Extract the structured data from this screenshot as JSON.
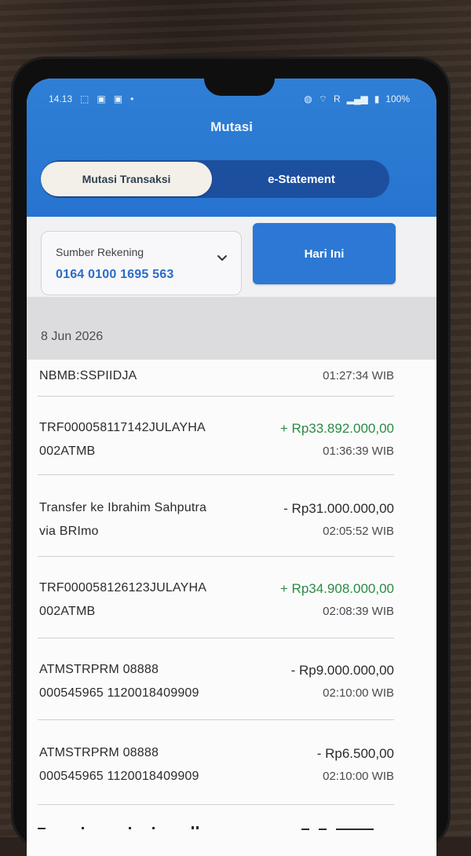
{
  "status_bar": {
    "time": "14.13",
    "battery": "100%",
    "network": "R"
  },
  "header": {
    "title": "Mutasi"
  },
  "tabs": [
    {
      "label": "Mutasi Transaksi",
      "active": true
    },
    {
      "label": "e-Statement",
      "active": false
    }
  ],
  "account": {
    "label": "Sumber Rekening",
    "value": "0164 0100 1695 563"
  },
  "filter_button": {
    "label": "Hari Ini"
  },
  "date_header": "8 Jun 2026",
  "transactions": [
    {
      "line1": "NBMB:SSPIIDJA",
      "line2": "",
      "amount": "",
      "time": "01:27:34 WIB",
      "type": ""
    },
    {
      "line1": "TRF000058117142JULAYHA",
      "line2": "002ATMB",
      "amount": "+ Rp33.892.000,00",
      "time": "01:36:39 WIB",
      "type": "credit"
    },
    {
      "line1": "Transfer ke Ibrahim Sahputra",
      "line2": "via BRImo",
      "amount": "- Rp31.000.000,00",
      "time": "02:05:52 WIB",
      "type": "debit"
    },
    {
      "line1": "TRF000058126123JULAYHA",
      "line2": "002ATMB",
      "amount": "+ Rp34.908.000,00",
      "time": "02:08:39 WIB",
      "type": "credit"
    },
    {
      "line1": "ATMSTRPRM 08888",
      "line2": "000545965 1120018409909",
      "amount": "- Rp9.000.000,00",
      "time": "02:10:00 WIB",
      "type": "debit"
    },
    {
      "line1": "ATMSTRPRM 08888",
      "line2": "000545965 1120018409909",
      "amount": "- Rp6.500,00",
      "time": "02:10:00 WIB",
      "type": "debit"
    }
  ],
  "icons": {
    "dropdown": "chevron-down-icon",
    "wifi": "wifi-icon",
    "battery": "battery-icon",
    "signal": "signal-icon"
  },
  "colors": {
    "brand_blue": "#2c78d4",
    "credit_green": "#2b8b44",
    "tab_bg": "#1d4f9f"
  }
}
